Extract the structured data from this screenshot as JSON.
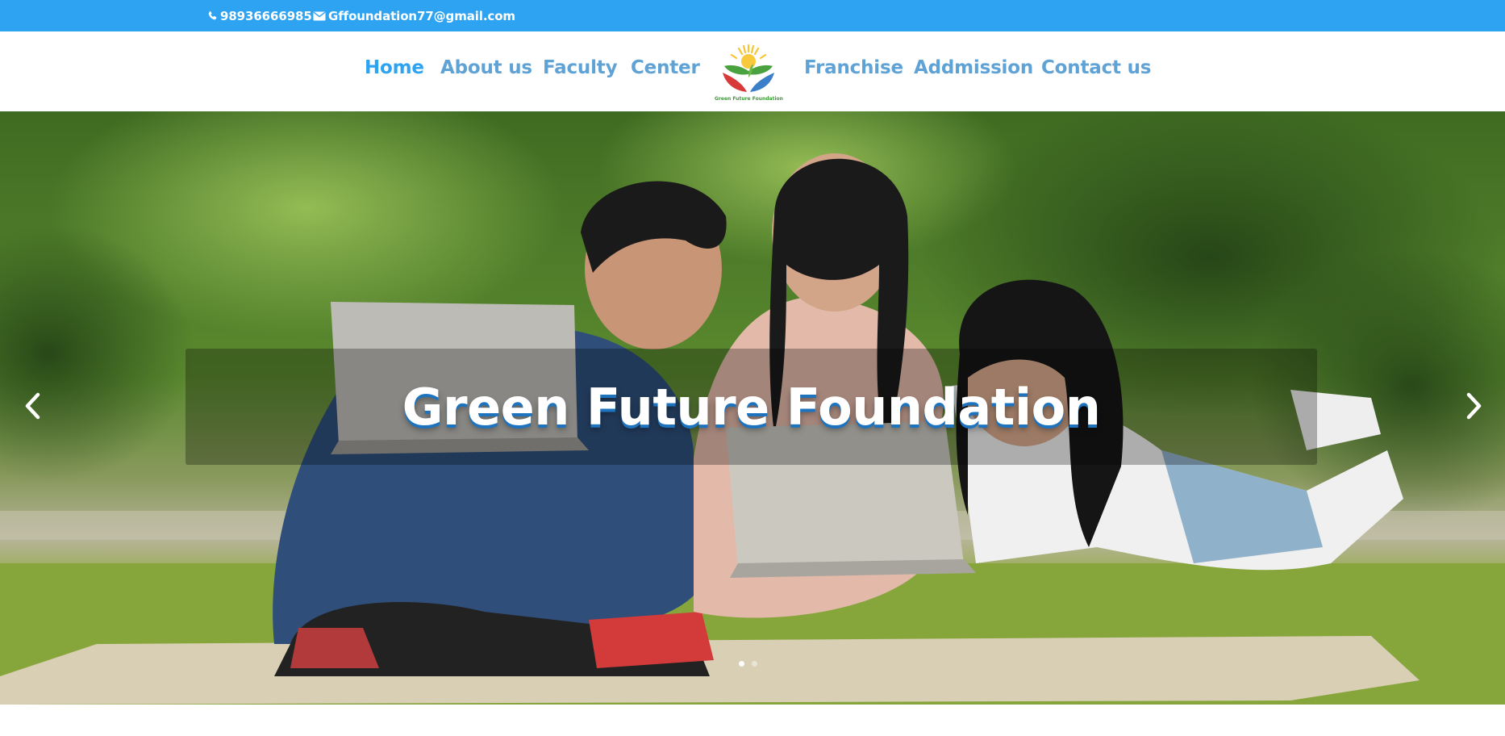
{
  "topbar": {
    "phone": "98936666985",
    "email": "Gffoundation77@gmail.com",
    "background_color": "#2ea3f2",
    "phone_icon": "phone-icon",
    "email_icon": "envelope-icon"
  },
  "nav": {
    "items": [
      {
        "label": "Home",
        "active": true
      },
      {
        "label": "About us"
      },
      {
        "label": "Faculty"
      },
      {
        "label": "Center"
      },
      {
        "label": "Franchise"
      },
      {
        "label": "Addmission"
      },
      {
        "label": "Contact us"
      }
    ],
    "active_color": "#2ea3f2",
    "link_color": "#5fa3d6"
  },
  "logo": {
    "text": "Green Future Foundation"
  },
  "slider": {
    "title": "Green Future Foundation",
    "prev_icon": "chevron-left-icon",
    "next_icon": "chevron-right-icon",
    "slide_count": 2,
    "active_slide": 1
  }
}
